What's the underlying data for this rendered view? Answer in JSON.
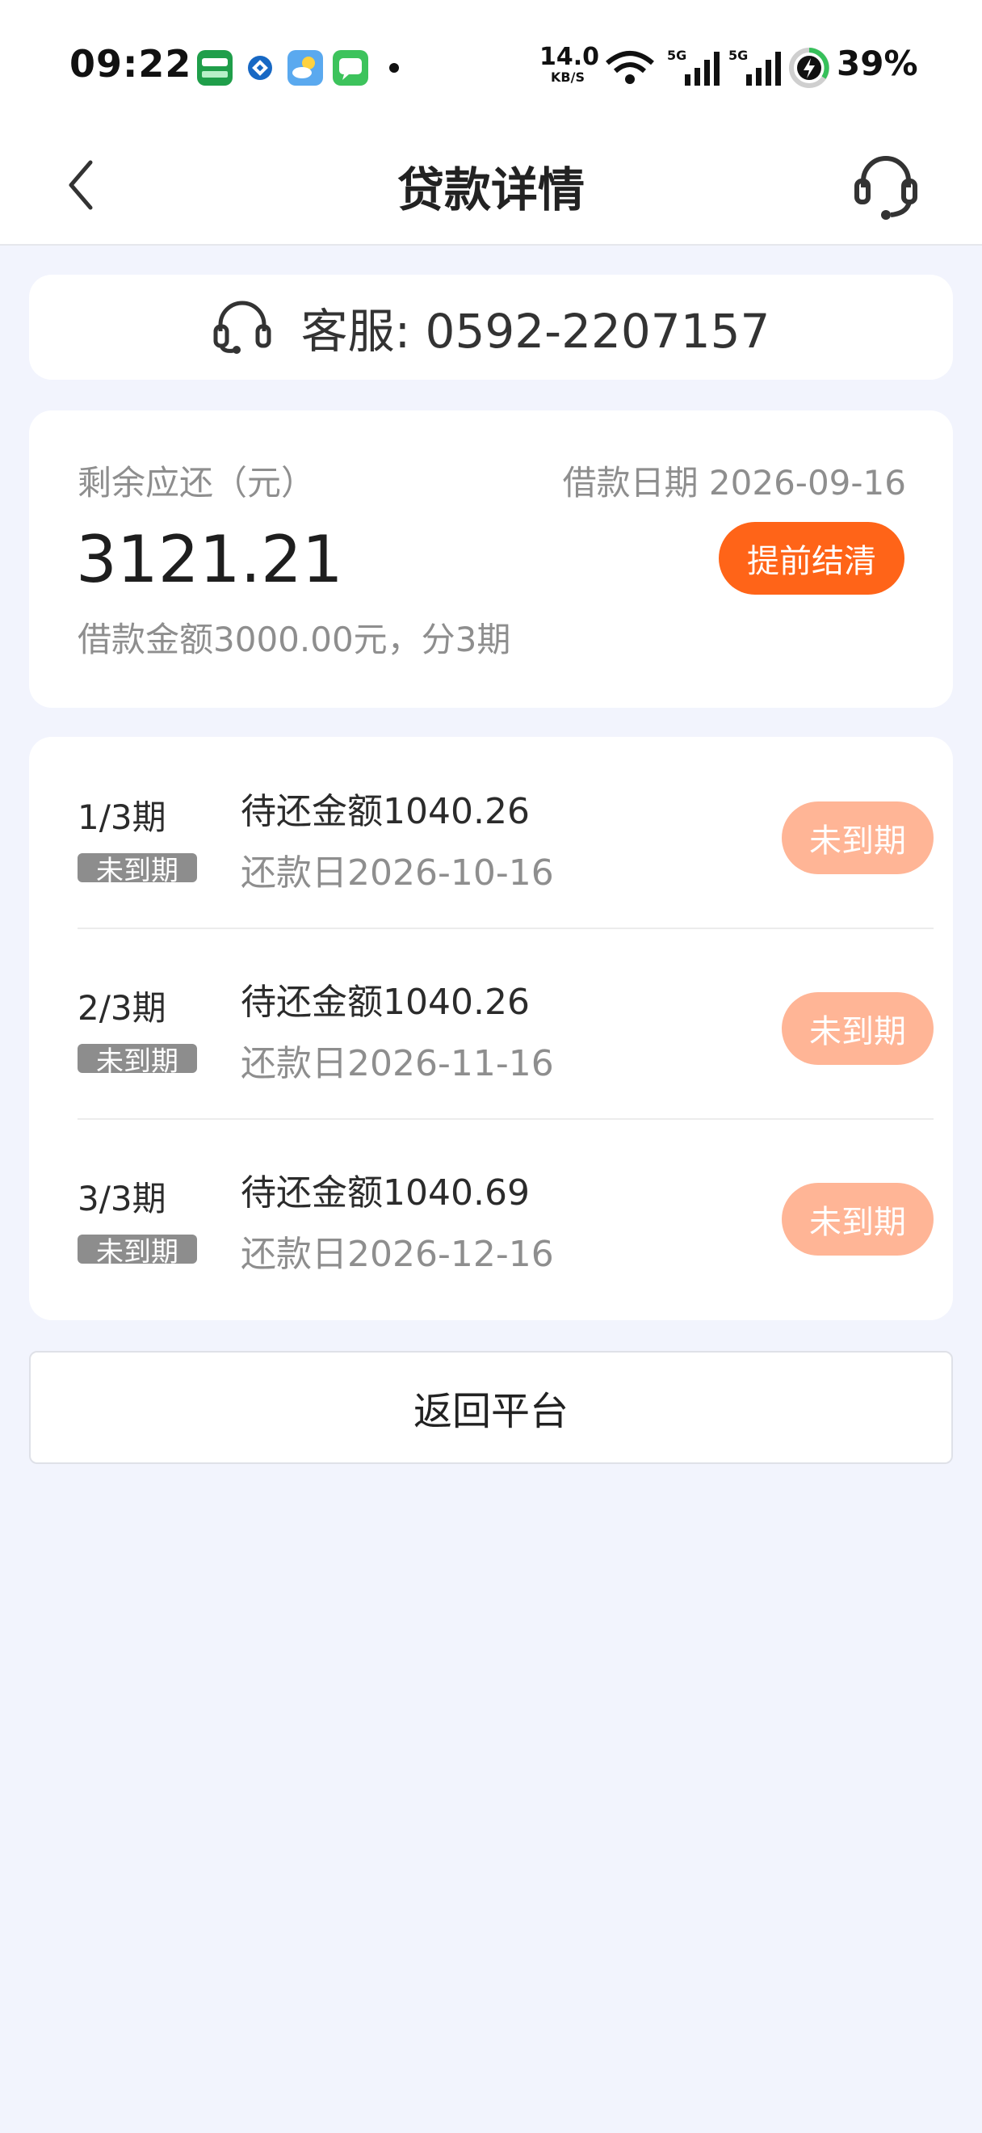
{
  "status_bar": {
    "time": "09:22",
    "net_speed_value": "14.0",
    "net_speed_unit": "KB/S",
    "battery_percent": "39%",
    "app_icons": [
      "oppo-app-icon",
      "ccb-bank-icon",
      "weather-icon",
      "messages-icon"
    ]
  },
  "nav": {
    "title": "贷款详情"
  },
  "service": {
    "phone_text": "客服: 0592-2207157"
  },
  "summary": {
    "remaining_label": "剩余应还（元）",
    "loan_date": "借款日期 2026-09-16",
    "remaining_amount": "3121.21",
    "payoff_button": "提前结清",
    "loan_info": "借款金额3000.00元，分3期"
  },
  "installments": [
    {
      "period": "1/3期",
      "badge": "未到期",
      "due_amount": "待还金额1040.26",
      "due_date": "还款日2026-10-16",
      "status": "未到期"
    },
    {
      "period": "2/3期",
      "badge": "未到期",
      "due_amount": "待还金额1040.26",
      "due_date": "还款日2026-11-16",
      "status": "未到期"
    },
    {
      "period": "3/3期",
      "badge": "未到期",
      "due_amount": "待还金额1040.69",
      "due_date": "还款日2026-12-16",
      "status": "未到期"
    }
  ],
  "footer": {
    "return_button": "返回平台"
  },
  "colors": {
    "accent": "#ff6418",
    "status_pill": "#ffb596",
    "background": "#f2f4fd"
  }
}
